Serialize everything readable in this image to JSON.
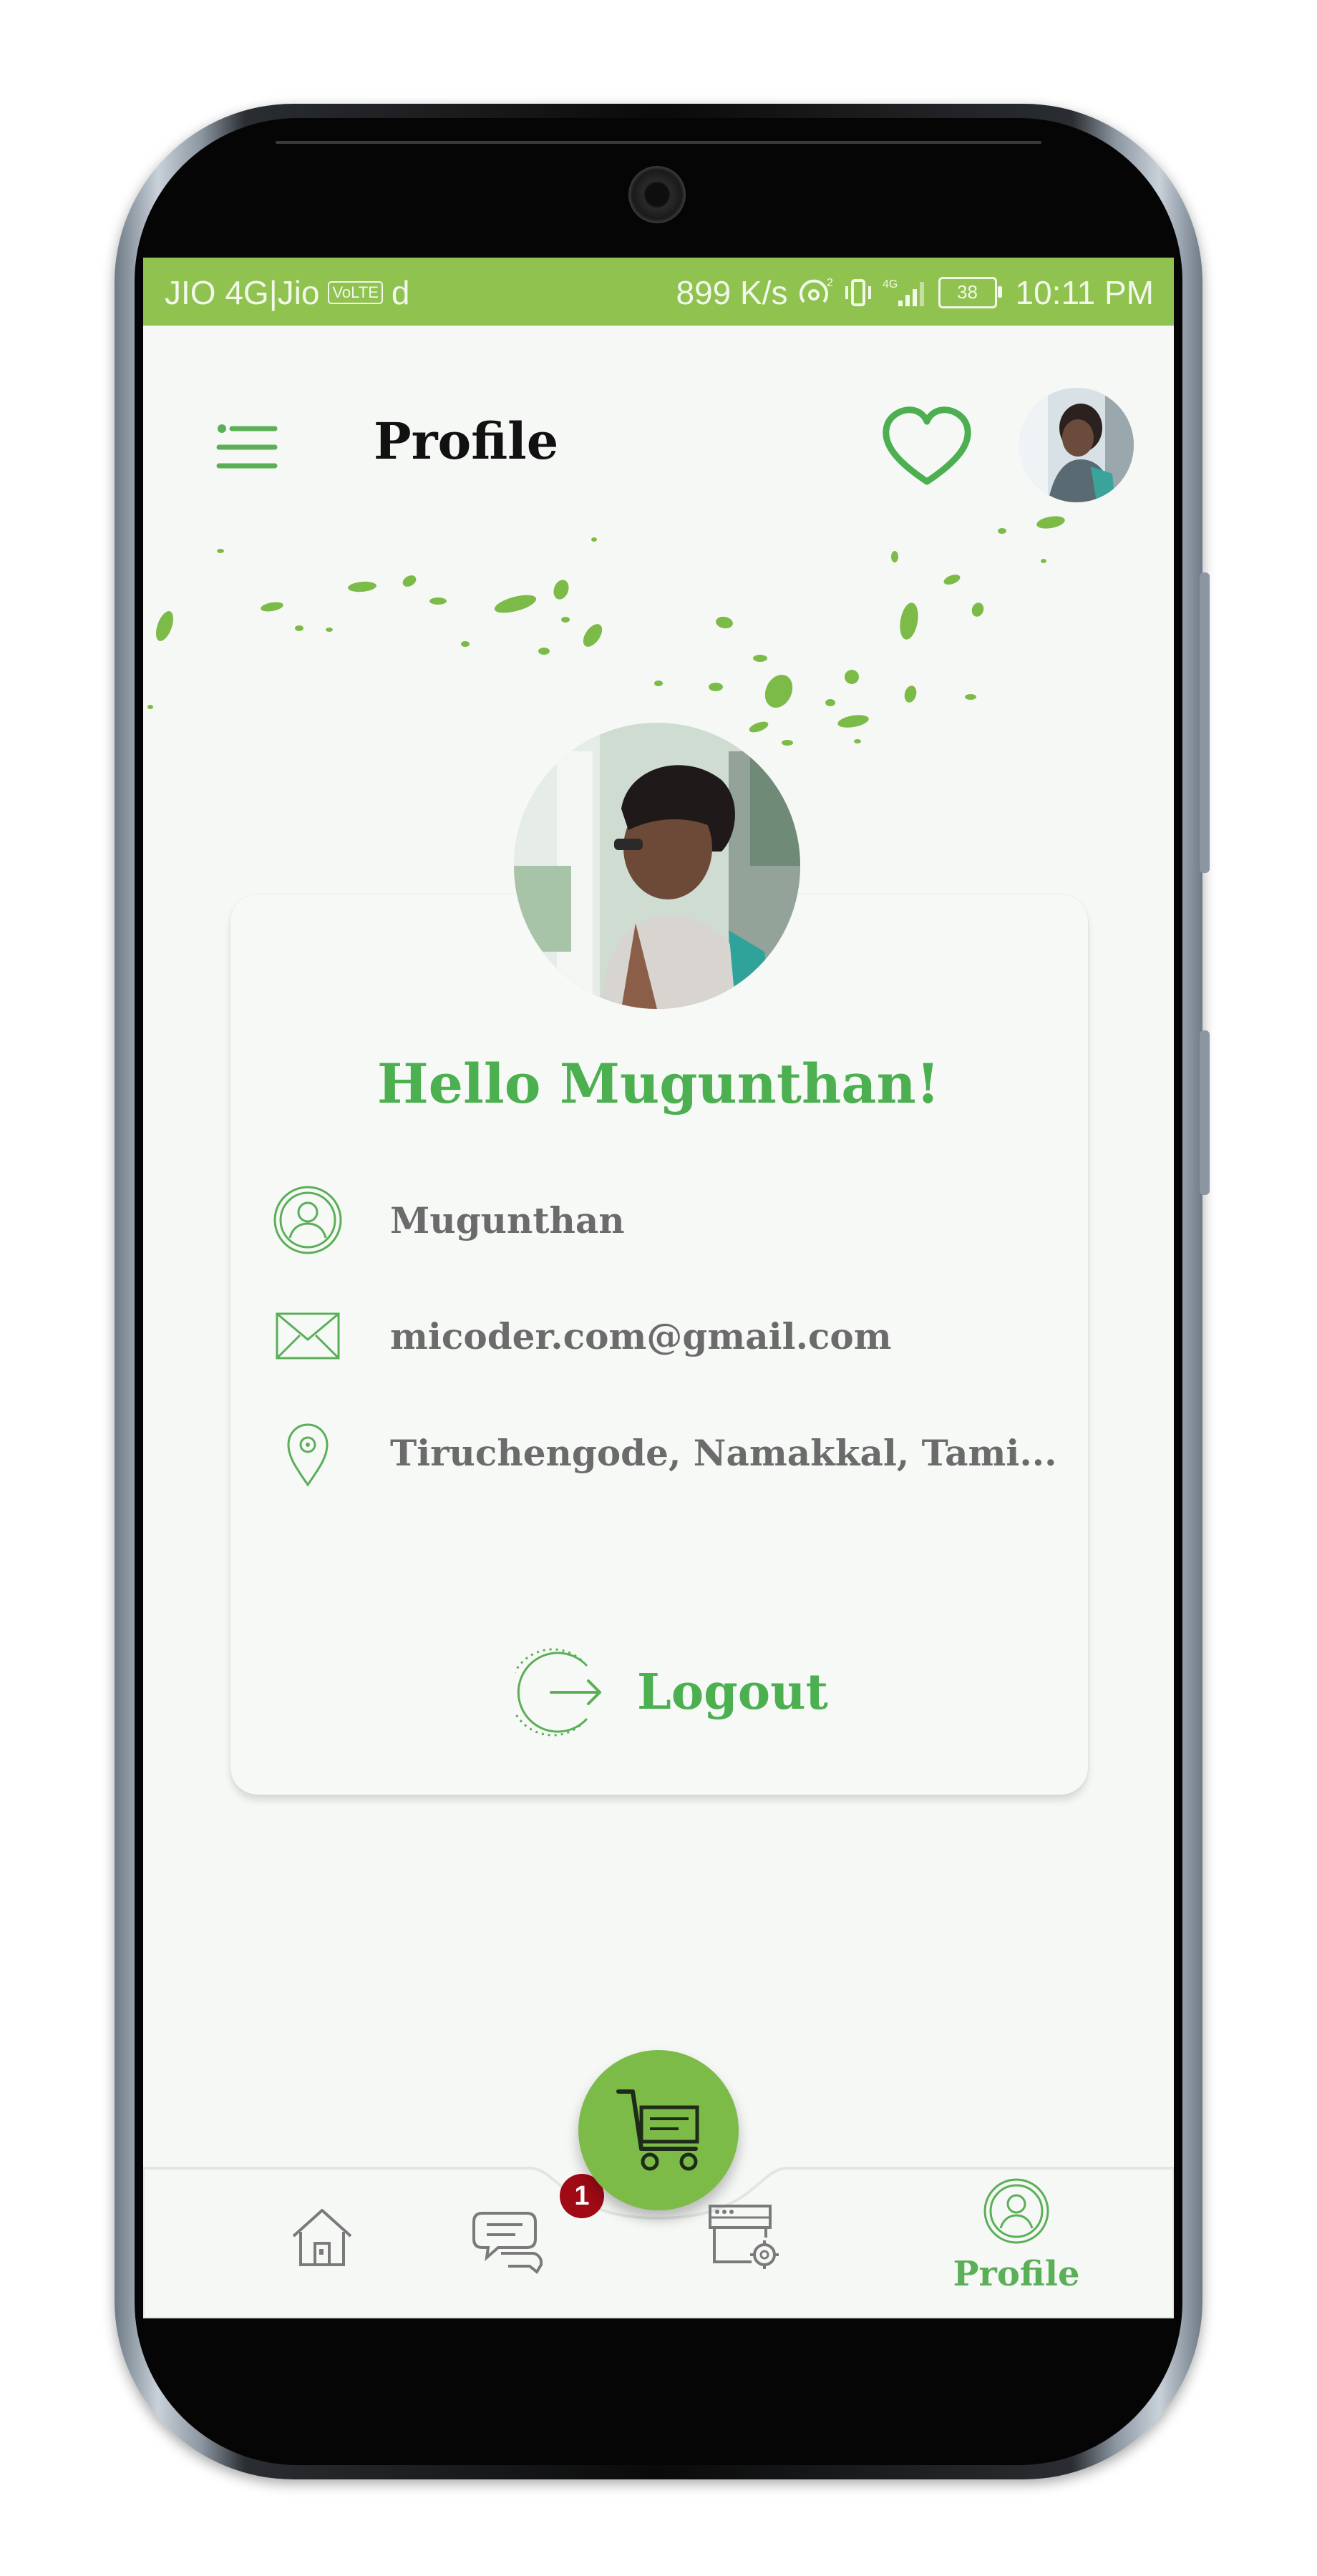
{
  "status_bar": {
    "carrier": "JIO 4G|Jio",
    "volte": "VoLTE",
    "extra": "d",
    "speed": "899 K/s",
    "battery": "38",
    "time": "10:11 PM"
  },
  "header": {
    "title": "Profile"
  },
  "profile": {
    "greeting": "Hello Mugunthan!",
    "name": "Mugunthan",
    "email": "micoder.com@gmail.com",
    "location": "Tiruchengode, Namakkal, Tami..."
  },
  "actions": {
    "logout_label": "Logout"
  },
  "bottom_nav": {
    "chat_badge": "1",
    "profile_label": "Profile"
  },
  "colors": {
    "accent": "#4caf50",
    "status_bar": "#8fc24e",
    "fab": "#7dbb48",
    "badge": "#a00a14"
  },
  "icons": [
    "menu-icon",
    "heart-icon",
    "user-icon",
    "mail-icon",
    "location-pin-icon",
    "logout-icon",
    "home-icon",
    "chat-icon",
    "shop-settings-icon",
    "cart-icon",
    "profile-icon"
  ]
}
